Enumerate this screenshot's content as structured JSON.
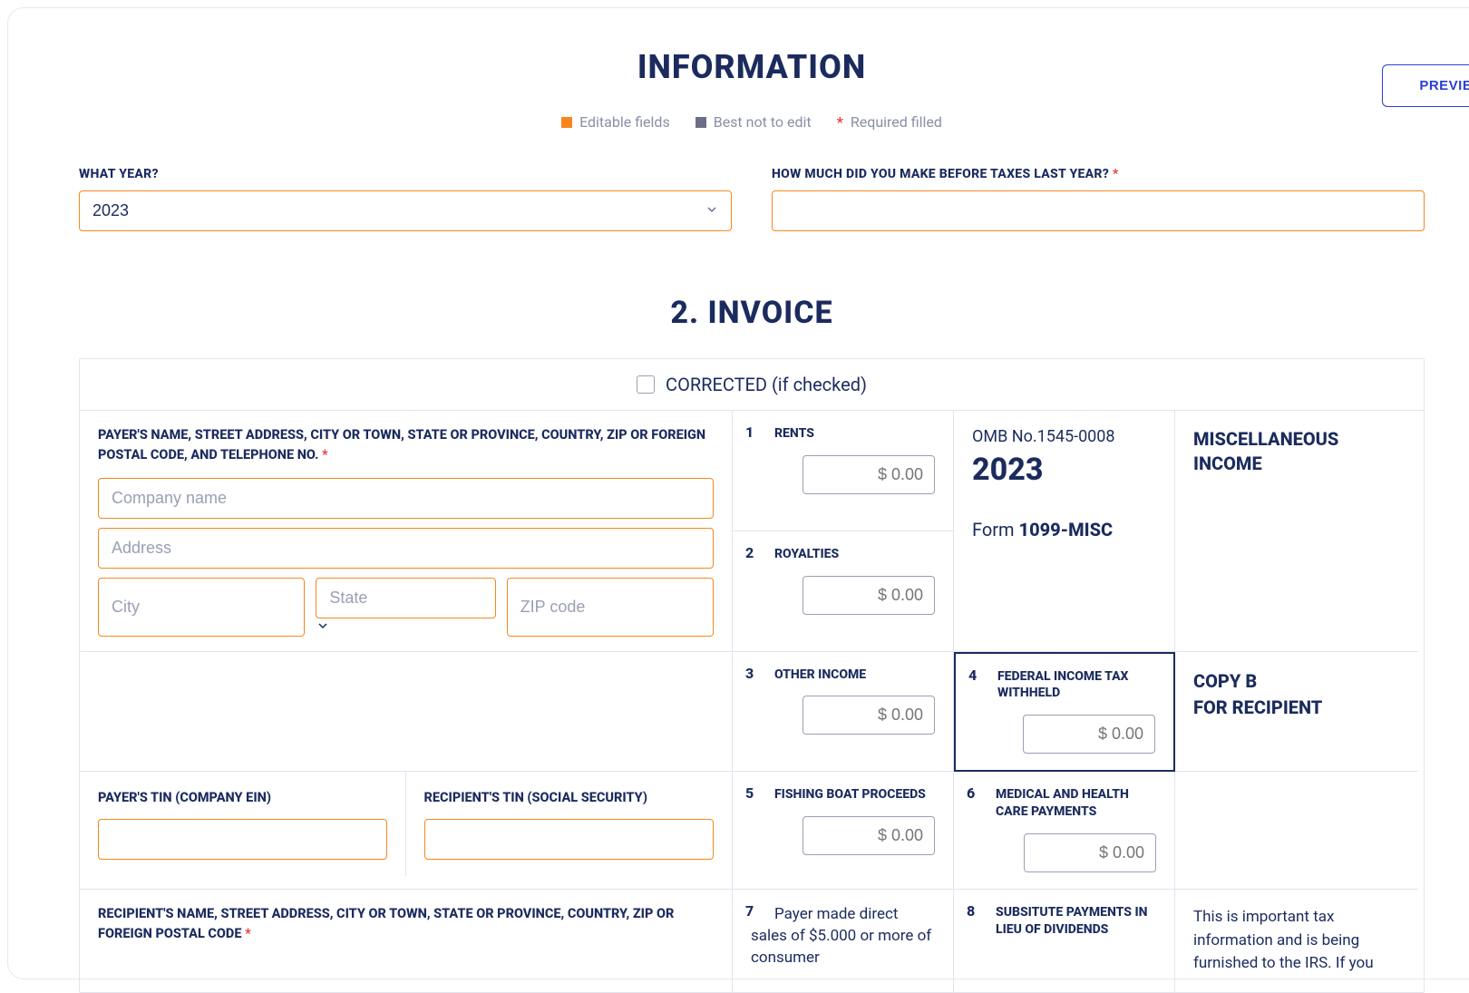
{
  "header": {
    "title": "INFORMATION",
    "preview_label": "PREVIEW"
  },
  "legend": {
    "editable": "Editable fields",
    "best_not": "Best not to edit",
    "required": "Required filled"
  },
  "info": {
    "year_label": "WHAT YEAR?",
    "year_value": "2023",
    "income_label": "HOW MUCH DID YOU MAKE BEFORE TAXES LAST YEAR?"
  },
  "invoice": {
    "title": "2. INVOICE",
    "corrected_label": "CORRECTED (if checked)",
    "payer_block_label": "PAYER'S NAME, STREET ADDRESS, CITY OR TOWN, STATE OR PROVINCE, COUNTRY, ZIP OR FOREIGN POSTAL CODE, AND TELEPHONE NO.",
    "placeholders": {
      "company": "Company name",
      "address": "Address",
      "city": "City",
      "state": "State",
      "zip": "ZIP code"
    },
    "payer_tin_label": "PAYER'S TIN (COMPANY EIN)",
    "recipient_tin_label": "RECIPIENT'S TIN (SOCIAL SECURITY)",
    "recipient_block_label": "RECIPIENT'S NAME, STREET ADDRESS, CITY OR TOWN, STATE OR PROVINCE, COUNTRY, ZIP OR FOREIGN POSTAL CODE",
    "omb": "OMB No.1545-0008",
    "year_big": "2023",
    "form_prefix": "Form",
    "form_name": "1099-MISC",
    "misc_income": "MISCELLANEOUS INCOME",
    "copy_b_1": "COPY B",
    "copy_b_2": "FOR RECIPIENT",
    "note": "This is important tax information and is being furnished to the IRS. If you",
    "money_ph": "$ 0.00",
    "boxes": {
      "b1": "RENTS",
      "b2": "ROYALTIES",
      "b3": "OTHER INCOME",
      "b4": "FEDERAL INCOME TAX WITHHELD",
      "b5": "FISHING BOAT PROCEEDS",
      "b6": "MEDICAL AND HEALTH CARE PAYMENTS",
      "b7": "Payer made direct sales of $5.000 or more of consumer",
      "b8": "SUBSITUTE PAYMENTS IN LIEU OF DIVIDENDS"
    },
    "nums": {
      "n1": "1",
      "n2": "2",
      "n3": "3",
      "n4": "4",
      "n5": "5",
      "n6": "6",
      "n7": "7",
      "n8": "8"
    }
  }
}
